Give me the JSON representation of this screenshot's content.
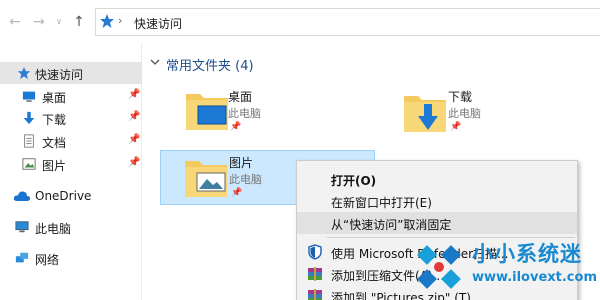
{
  "address": {
    "path": "快速访问"
  },
  "sidebar": {
    "quick_access": "快速访问",
    "items": [
      {
        "label": "桌面"
      },
      {
        "label": "下载"
      },
      {
        "label": "文档"
      },
      {
        "label": "图片"
      }
    ],
    "onedrive": "OneDrive",
    "this_pc": "此电脑",
    "network": "网络"
  },
  "main": {
    "group_title": "常用文件夹 (4)",
    "folders": [
      {
        "name": "桌面",
        "location": "此电脑"
      },
      {
        "name": "下载",
        "location": "此电脑"
      },
      {
        "name": "图片",
        "location": "此电脑"
      }
    ]
  },
  "context_menu": {
    "items": [
      {
        "label": "打开(O)"
      },
      {
        "label": "在新窗口中打开(E)"
      },
      {
        "label": "从“快速访问”取消固定"
      },
      {
        "label": "使用 Microsoft Defender扫描..."
      },
      {
        "label": "添加到压缩文件(A)..."
      },
      {
        "label": "添加到 \"Pictures.zip\" (T)"
      }
    ]
  },
  "watermark": {
    "title": "小小系统迷",
    "url": "www.ilovext.com"
  },
  "colors": {
    "accent": "#1e4e8c",
    "selection": "#cce8ff",
    "folder": "#f4c95d",
    "link": "#1a8ad0"
  }
}
